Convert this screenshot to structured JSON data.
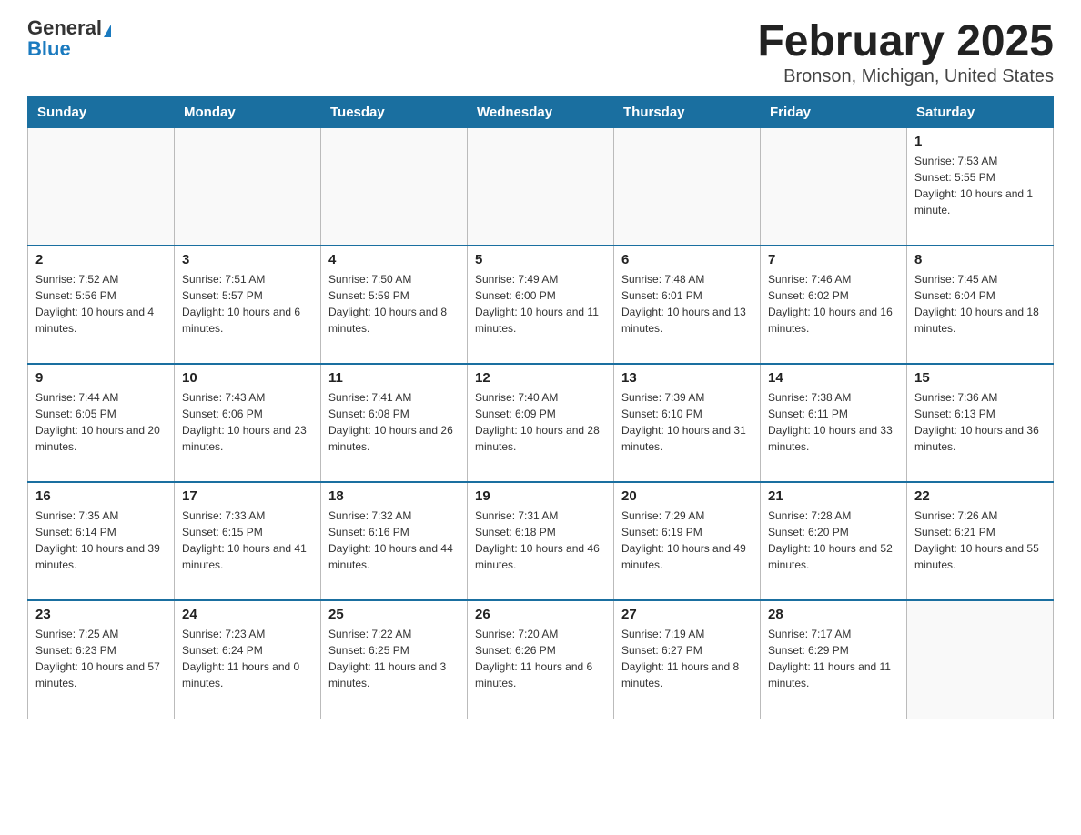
{
  "header": {
    "logo_general": "General",
    "logo_blue": "Blue",
    "month_title": "February 2025",
    "location": "Bronson, Michigan, United States"
  },
  "days_of_week": [
    "Sunday",
    "Monday",
    "Tuesday",
    "Wednesday",
    "Thursday",
    "Friday",
    "Saturday"
  ],
  "weeks": [
    [
      {
        "day": "",
        "info": ""
      },
      {
        "day": "",
        "info": ""
      },
      {
        "day": "",
        "info": ""
      },
      {
        "day": "",
        "info": ""
      },
      {
        "day": "",
        "info": ""
      },
      {
        "day": "",
        "info": ""
      },
      {
        "day": "1",
        "info": "Sunrise: 7:53 AM\nSunset: 5:55 PM\nDaylight: 10 hours and 1 minute."
      }
    ],
    [
      {
        "day": "2",
        "info": "Sunrise: 7:52 AM\nSunset: 5:56 PM\nDaylight: 10 hours and 4 minutes."
      },
      {
        "day": "3",
        "info": "Sunrise: 7:51 AM\nSunset: 5:57 PM\nDaylight: 10 hours and 6 minutes."
      },
      {
        "day": "4",
        "info": "Sunrise: 7:50 AM\nSunset: 5:59 PM\nDaylight: 10 hours and 8 minutes."
      },
      {
        "day": "5",
        "info": "Sunrise: 7:49 AM\nSunset: 6:00 PM\nDaylight: 10 hours and 11 minutes."
      },
      {
        "day": "6",
        "info": "Sunrise: 7:48 AM\nSunset: 6:01 PM\nDaylight: 10 hours and 13 minutes."
      },
      {
        "day": "7",
        "info": "Sunrise: 7:46 AM\nSunset: 6:02 PM\nDaylight: 10 hours and 16 minutes."
      },
      {
        "day": "8",
        "info": "Sunrise: 7:45 AM\nSunset: 6:04 PM\nDaylight: 10 hours and 18 minutes."
      }
    ],
    [
      {
        "day": "9",
        "info": "Sunrise: 7:44 AM\nSunset: 6:05 PM\nDaylight: 10 hours and 20 minutes."
      },
      {
        "day": "10",
        "info": "Sunrise: 7:43 AM\nSunset: 6:06 PM\nDaylight: 10 hours and 23 minutes."
      },
      {
        "day": "11",
        "info": "Sunrise: 7:41 AM\nSunset: 6:08 PM\nDaylight: 10 hours and 26 minutes."
      },
      {
        "day": "12",
        "info": "Sunrise: 7:40 AM\nSunset: 6:09 PM\nDaylight: 10 hours and 28 minutes."
      },
      {
        "day": "13",
        "info": "Sunrise: 7:39 AM\nSunset: 6:10 PM\nDaylight: 10 hours and 31 minutes."
      },
      {
        "day": "14",
        "info": "Sunrise: 7:38 AM\nSunset: 6:11 PM\nDaylight: 10 hours and 33 minutes."
      },
      {
        "day": "15",
        "info": "Sunrise: 7:36 AM\nSunset: 6:13 PM\nDaylight: 10 hours and 36 minutes."
      }
    ],
    [
      {
        "day": "16",
        "info": "Sunrise: 7:35 AM\nSunset: 6:14 PM\nDaylight: 10 hours and 39 minutes."
      },
      {
        "day": "17",
        "info": "Sunrise: 7:33 AM\nSunset: 6:15 PM\nDaylight: 10 hours and 41 minutes."
      },
      {
        "day": "18",
        "info": "Sunrise: 7:32 AM\nSunset: 6:16 PM\nDaylight: 10 hours and 44 minutes."
      },
      {
        "day": "19",
        "info": "Sunrise: 7:31 AM\nSunset: 6:18 PM\nDaylight: 10 hours and 46 minutes."
      },
      {
        "day": "20",
        "info": "Sunrise: 7:29 AM\nSunset: 6:19 PM\nDaylight: 10 hours and 49 minutes."
      },
      {
        "day": "21",
        "info": "Sunrise: 7:28 AM\nSunset: 6:20 PM\nDaylight: 10 hours and 52 minutes."
      },
      {
        "day": "22",
        "info": "Sunrise: 7:26 AM\nSunset: 6:21 PM\nDaylight: 10 hours and 55 minutes."
      }
    ],
    [
      {
        "day": "23",
        "info": "Sunrise: 7:25 AM\nSunset: 6:23 PM\nDaylight: 10 hours and 57 minutes."
      },
      {
        "day": "24",
        "info": "Sunrise: 7:23 AM\nSunset: 6:24 PM\nDaylight: 11 hours and 0 minutes."
      },
      {
        "day": "25",
        "info": "Sunrise: 7:22 AM\nSunset: 6:25 PM\nDaylight: 11 hours and 3 minutes."
      },
      {
        "day": "26",
        "info": "Sunrise: 7:20 AM\nSunset: 6:26 PM\nDaylight: 11 hours and 6 minutes."
      },
      {
        "day": "27",
        "info": "Sunrise: 7:19 AM\nSunset: 6:27 PM\nDaylight: 11 hours and 8 minutes."
      },
      {
        "day": "28",
        "info": "Sunrise: 7:17 AM\nSunset: 6:29 PM\nDaylight: 11 hours and 11 minutes."
      },
      {
        "day": "",
        "info": ""
      }
    ]
  ]
}
